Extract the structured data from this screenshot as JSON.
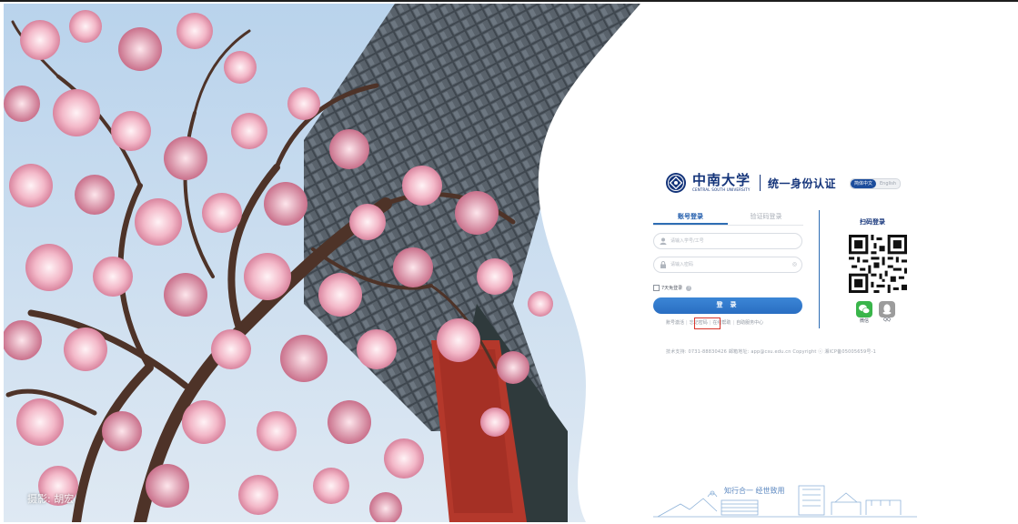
{
  "photo": {
    "caption": "摄影: 胡宏"
  },
  "header": {
    "university_name": "中南大学",
    "university_en": "CENTRAL SOUTH UNIVERSITY",
    "system_title": "统一身份认证",
    "lang_zh": "简体中文",
    "lang_en": "English"
  },
  "login": {
    "tab_account": "账号登录",
    "tab_code": "验证码登录",
    "username_placeholder": "请输入学号/工号",
    "password_placeholder": "请输入密码",
    "remember_label": "7天免登录",
    "submit_label": "登 录",
    "links": [
      "账号激活",
      "忘记密码",
      "在线帮助",
      "自助服务中心"
    ]
  },
  "scan": {
    "title": "扫码登录",
    "wechat_label": "微信",
    "qq_label": "QQ"
  },
  "footer": {
    "text": "技术支持: 0731-88830426 邮箱地址: app@csu.edu.cn Copyright ⓒ 湘ICP备05005659号-1"
  },
  "slogan": {
    "text": "知行合一  经世致用"
  },
  "colors": {
    "brand": "#14347a",
    "accent": "#2e6db4",
    "highlight": "#d9342b",
    "wechat": "#39b54a"
  }
}
